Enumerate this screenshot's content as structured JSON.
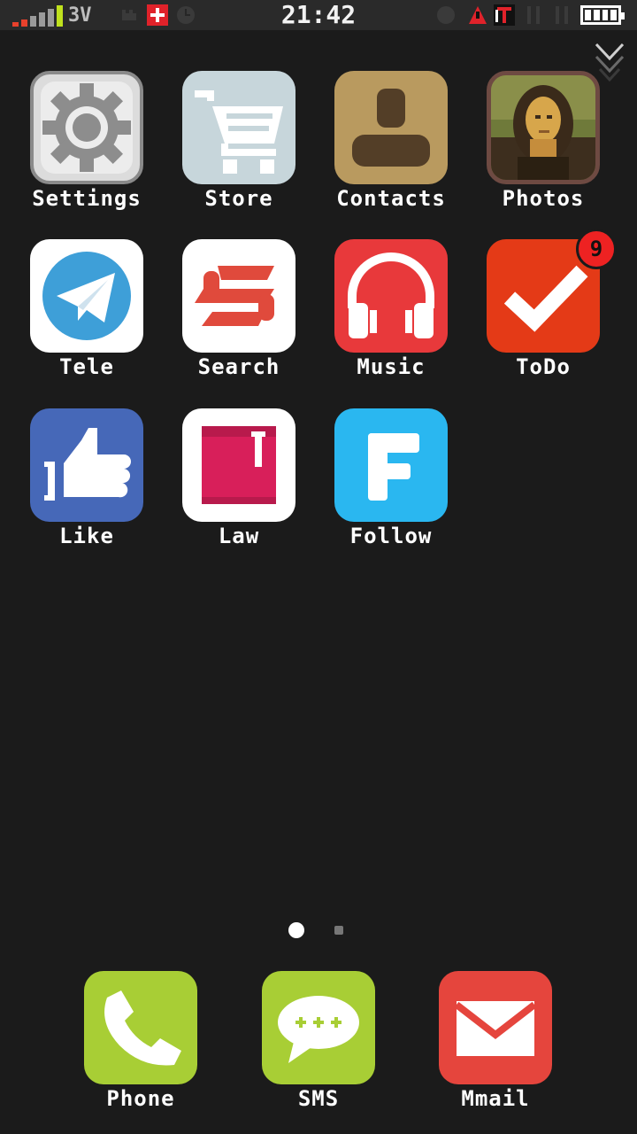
{
  "status_bar": {
    "network_label": "3V",
    "time": "21:42",
    "signal_colors": [
      "#e8412c",
      "#e8412c",
      "#9a9a9a",
      "#9a9a9a",
      "#9a9a9a",
      "#bfe11d"
    ],
    "battery_level": 1.0
  },
  "apps": [
    {
      "label": "Settings",
      "icon": "settings-gear-icon",
      "bg": "#ededed"
    },
    {
      "label": "Store",
      "icon": "shopping-cart-icon",
      "bg": "#c7d6db"
    },
    {
      "label": "Contacts",
      "icon": "contact-person-icon",
      "bg": "#b99a5f"
    },
    {
      "label": "Photos",
      "icon": "mona-lisa-photo-icon",
      "bg": "#7a5a3a"
    },
    {
      "label": "Tele",
      "icon": "telegram-plane-icon",
      "bg": "#ffffff"
    },
    {
      "label": "Search",
      "icon": "search-s-logo-icon",
      "bg": "#ffffff"
    },
    {
      "label": "Music",
      "icon": "headphones-icon",
      "bg": "#e8393b"
    },
    {
      "label": "ToDo",
      "icon": "checkmark-icon",
      "bg": "#e43a17",
      "badge": "9"
    },
    {
      "label": "Like",
      "icon": "thumbs-up-icon",
      "bg": "#4668b8"
    },
    {
      "label": "Law",
      "icon": "law-book-icon",
      "bg": "#ffffff"
    },
    {
      "label": "Follow",
      "icon": "follow-f-icon",
      "bg": "#2ab7f0"
    }
  ],
  "pagination": {
    "pages": 2,
    "current": 1
  },
  "dock": [
    {
      "label": "Phone",
      "icon": "phone-handset-icon",
      "bg": "#a8ce35"
    },
    {
      "label": "SMS",
      "icon": "sms-bubble-icon",
      "bg": "#a8ce35"
    },
    {
      "label": "Mmail",
      "icon": "mail-envelope-icon",
      "bg": "#e5453d"
    }
  ]
}
